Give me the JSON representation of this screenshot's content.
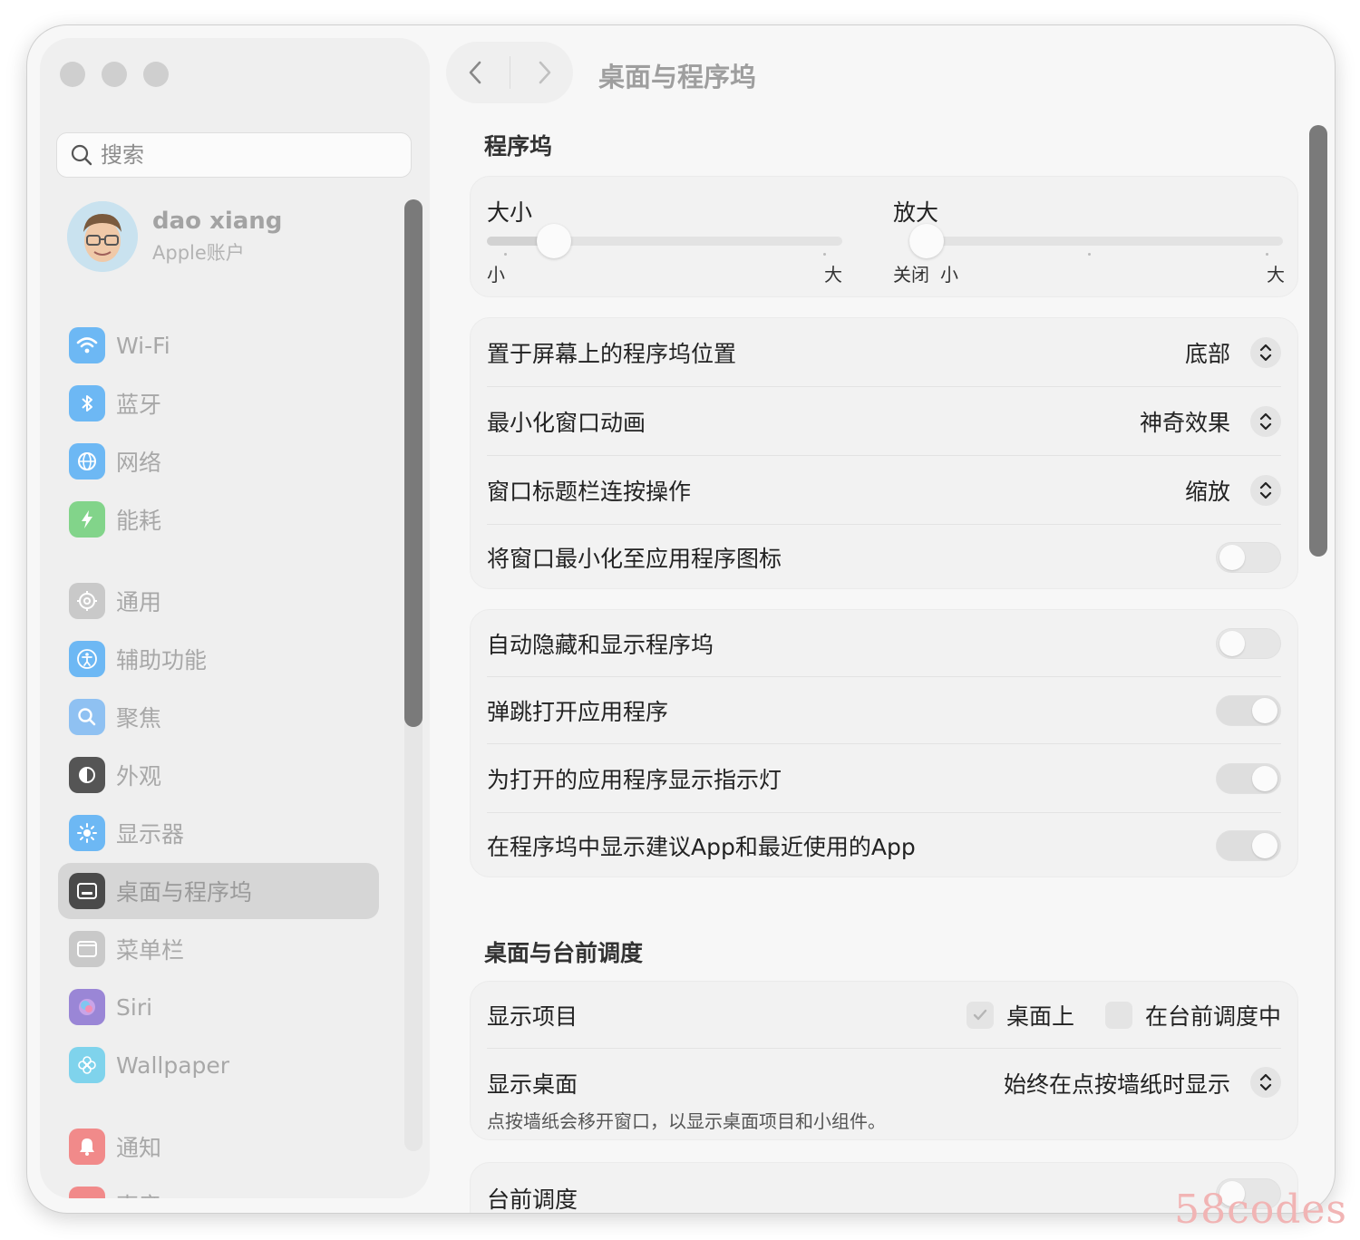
{
  "window": {
    "title": "桌面与程序坞"
  },
  "sidebar": {
    "search_placeholder": "搜索",
    "account": {
      "name": "dao xiang",
      "subtitle": "Apple账户"
    },
    "items": [
      {
        "label": "Wi-Fi",
        "icon": "wifi-icon",
        "color": "#4aa8f5"
      },
      {
        "label": "蓝牙",
        "icon": "bluetooth-icon",
        "color": "#4aa8f5"
      },
      {
        "label": "网络",
        "icon": "globe-icon",
        "color": "#4aa8f5"
      },
      {
        "label": "能耗",
        "icon": "battery-bolt-icon",
        "color": "#5ec96a"
      },
      {
        "label": "通用",
        "icon": "gear-icon",
        "color": "#a0a0a0"
      },
      {
        "label": "辅助功能",
        "icon": "accessibility-icon",
        "color": "#4aa8f5"
      },
      {
        "label": "聚焦",
        "icon": "magnifier-icon",
        "color": "#5aa8ee"
      },
      {
        "label": "外观",
        "icon": "appearance-icon",
        "color": "#3a3a3a"
      },
      {
        "label": "显示器",
        "icon": "brightness-icon",
        "color": "#4aa8f5"
      },
      {
        "label": "桌面与程序坞",
        "icon": "dock-icon",
        "color": "#3a3a3a",
        "active": true
      },
      {
        "label": "菜单栏",
        "icon": "menubar-icon",
        "color": "#a8a8a8"
      },
      {
        "label": "Siri",
        "icon": "siri-icon",
        "color": "#8a6fd8"
      },
      {
        "label": "Wallpaper",
        "icon": "flower-icon",
        "color": "#5ac8e8"
      },
      {
        "label": "通知",
        "icon": "bell-icon",
        "color": "#f06a6a"
      },
      {
        "label": "声音",
        "icon": "speaker-icon",
        "color": "#f06a6a"
      }
    ]
  },
  "main": {
    "dock_section": {
      "title": "程序坞",
      "size": {
        "label": "大小",
        "min_label": "小",
        "max_label": "大",
        "value_fraction": 0.14
      },
      "magnification": {
        "label": "放大",
        "off_label": "关闭",
        "min_label": "小",
        "max_label": "大",
        "value_fraction": 0.0
      },
      "popups": [
        {
          "label": "置于屏幕上的程序坞位置",
          "value": "底部"
        },
        {
          "label": "最小化窗口动画",
          "value": "神奇效果"
        },
        {
          "label": "窗口标题栏连按操作",
          "value": "缩放"
        }
      ],
      "minimize_to_icon": {
        "label": "将窗口最小化至应用程序图标",
        "on": false
      },
      "toggles": [
        {
          "label": "自动隐藏和显示程序坞",
          "on": false
        },
        {
          "label": "弹跳打开应用程序",
          "on": true
        },
        {
          "label": "为打开的应用程序显示指示灯",
          "on": true
        },
        {
          "label": "在程序坞中显示建议App和最近使用的App",
          "on": true
        }
      ]
    },
    "desktop_section": {
      "title": "桌面与台前调度",
      "show_items": {
        "label": "显示项目",
        "option1": {
          "label": "桌面上",
          "checked": true
        },
        "option2": {
          "label": "在台前调度中",
          "checked": false
        }
      },
      "show_desktop": {
        "label": "显示桌面",
        "value": "始终在点按墙纸时显示",
        "description": "点按墙纸会移开窗口，以显示桌面项目和小组件。"
      },
      "stage_manager": {
        "label": "台前调度",
        "on": false
      }
    }
  },
  "watermark": "58codes"
}
